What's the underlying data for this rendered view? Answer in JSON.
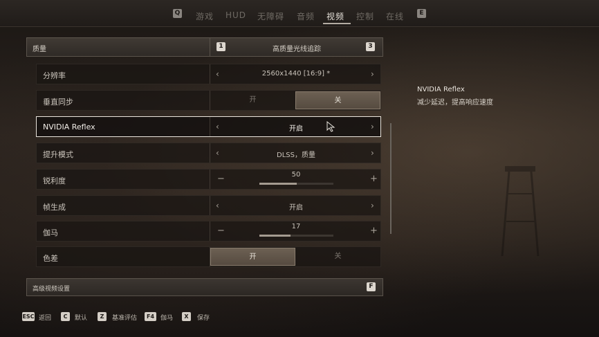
{
  "nav": {
    "left_key": "Q",
    "right_key": "E",
    "tabs": [
      "游戏",
      "HUD",
      "无障碍",
      "音频",
      "视频",
      "控制",
      "在线"
    ],
    "active_tab": "视频"
  },
  "group": {
    "title": "质量",
    "preset": "高质量光线追踪",
    "prev_key": "1",
    "next_key": "3"
  },
  "settings": {
    "resolution": {
      "label": "分辨率",
      "value": "2560x1440 [16:9] *"
    },
    "vsync": {
      "label": "垂直同步",
      "on": "开",
      "off": "关",
      "selected": "关"
    },
    "reflex": {
      "label": "NVIDIA Reflex",
      "value": "开启"
    },
    "upscale": {
      "label": "提升模式",
      "value": "DLSS，质量"
    },
    "sharpness": {
      "label": "锐利度",
      "value": "50",
      "fraction": 0.5
    },
    "framegen": {
      "label": "帧生成",
      "value": "开启"
    },
    "gamma": {
      "label": "伽马",
      "value": "17",
      "fraction": 0.42
    },
    "chromatic": {
      "label": "色差",
      "on": "开",
      "off": "关",
      "selected": "开"
    }
  },
  "advanced": {
    "label": "高级视频设置",
    "key": "F"
  },
  "info": {
    "title": "NVIDIA Reflex",
    "description": "减少延迟，提高响应速度"
  },
  "hints": [
    {
      "key": "ESC",
      "label": "返回"
    },
    {
      "key": "C",
      "label": "默认"
    },
    {
      "key": "Z",
      "label": "基准评估"
    },
    {
      "key": "F4",
      "label": "伽马"
    },
    {
      "key": "X",
      "label": "保存"
    }
  ]
}
